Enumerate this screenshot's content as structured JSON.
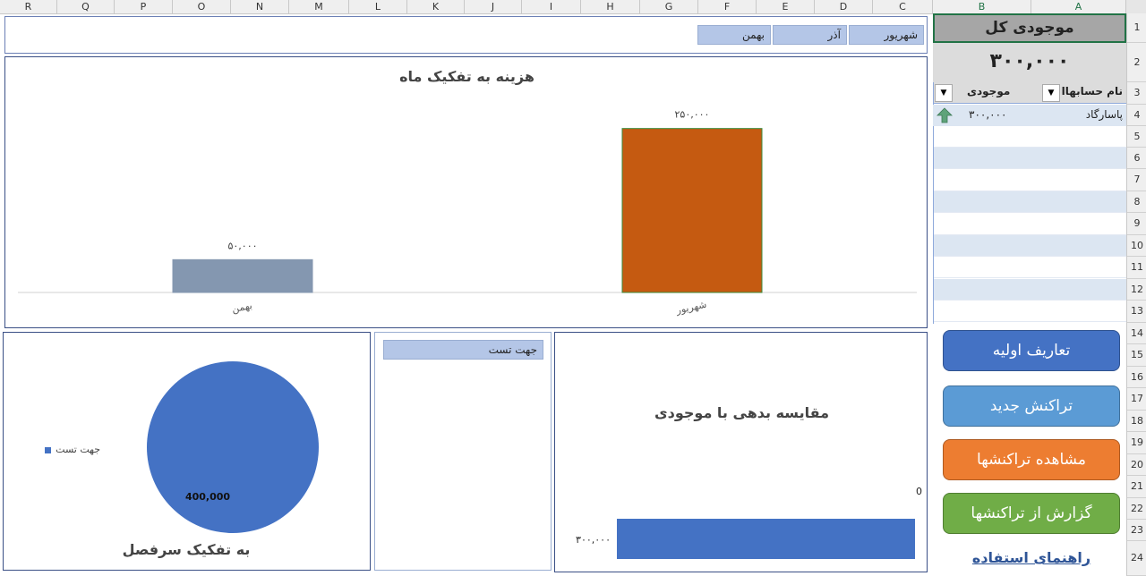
{
  "columns": [
    "R",
    "Q",
    "P",
    "O",
    "N",
    "M",
    "L",
    "K",
    "J",
    "I",
    "H",
    "G",
    "F",
    "E",
    "D",
    "C",
    "B",
    "A"
  ],
  "rows": [
    "1",
    "2",
    "3",
    "4",
    "5",
    "6",
    "7",
    "8",
    "9",
    "10",
    "11",
    "12",
    "13",
    "14",
    "15",
    "16",
    "17",
    "18",
    "19",
    "20",
    "21",
    "22",
    "23",
    "24"
  ],
  "summary": {
    "title": "موجودی کل",
    "total": "۳۰۰,۰۰۰",
    "header_account": "نام حسابهاا",
    "header_balance": "موجودی",
    "account_name": "پاسارگاد",
    "account_balance": "۳۰۰,۰۰۰"
  },
  "month_slicer": [
    "شهریور",
    "آذر",
    "بهمن"
  ],
  "account_slicer": [
    "جهت تست"
  ],
  "buttons": {
    "definitions": "تعاریف اولیه",
    "new_transaction": "تراکنش جدید",
    "view_transactions": "مشاهده تراکنشها",
    "report": "گزارش از تراکنشها",
    "help": "راهنمای استفاده"
  },
  "chart_data": [
    {
      "type": "bar",
      "title": "هزینه به تفکیک ماه",
      "categories": [
        "بهمن",
        "شهریور"
      ],
      "values": [
        50000,
        250000
      ],
      "value_labels": [
        "۵۰,۰۰۰",
        "۲۵۰,۰۰۰"
      ],
      "colors": [
        "#8497b0",
        "#c55a11"
      ],
      "ylim": [
        0,
        300000
      ]
    },
    {
      "type": "pie",
      "title": "به تفکیک سرفصل",
      "categories": [
        "جهت تست"
      ],
      "values": [
        400000
      ],
      "value_labels": [
        "400,000"
      ],
      "colors": [
        "#4472c4"
      ],
      "legend": "left"
    },
    {
      "type": "bar",
      "orientation": "horizontal",
      "title": "مقایسه بدهی با موجودی",
      "series": [
        {
          "values": [
            0
          ],
          "value_labels": [
            "0"
          ]
        },
        {
          "values": [
            300000
          ],
          "value_labels": [
            "۳۰۰,۰۰۰"
          ]
        }
      ],
      "colors": [
        "#4472c4"
      ]
    }
  ],
  "colors": {
    "accent_blue": "#4472c4",
    "light_blue": "#5b9bd5",
    "orange": "#ed7d31",
    "green": "#70ad47",
    "panel_border": "#3a4f86"
  }
}
